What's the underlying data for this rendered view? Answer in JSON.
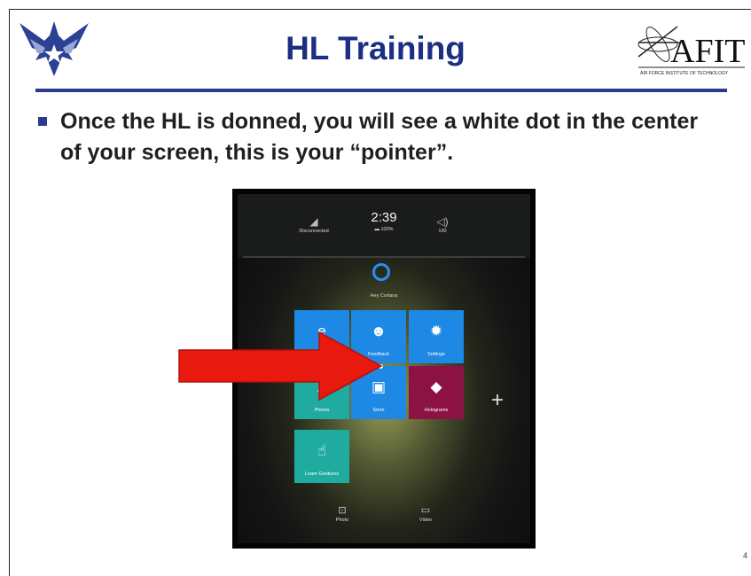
{
  "header": {
    "title": "HL Training"
  },
  "logos": {
    "right_logo_text": "AFIT",
    "right_logo_subtext": "AIR FORCE INSTITUTE OF TECHNOLOGY"
  },
  "bullet": {
    "text": "Once the HL is donned, you will see a white dot in the center of your screen, this is your “pointer”."
  },
  "holo_menu": {
    "status": {
      "network": {
        "icon": "wifi-off-icon",
        "label": "Disconnected"
      },
      "time": "2:39",
      "battery": {
        "icon": "battery-icon",
        "label": "100%"
      },
      "volume": {
        "icon": "volume-icon",
        "label": "100"
      }
    },
    "cortana": {
      "icon": "cortana-icon",
      "label": "Hey Cortana"
    },
    "tiles": [
      {
        "icon": "edge-icon",
        "glyph": "e",
        "label": "",
        "color": "#1e88e5"
      },
      {
        "icon": "feedback-icon",
        "glyph": "☻",
        "label": "Feedback",
        "color": "#1e88e5"
      },
      {
        "icon": "settings-icon",
        "glyph": "✹",
        "label": "Settings",
        "color": "#1e88e5"
      },
      {
        "icon": "photos-icon",
        "glyph": "▲",
        "label": "Photos",
        "color": "#1fab9f"
      },
      {
        "icon": "store-icon",
        "glyph": "▣",
        "label": "Store",
        "color": "#1e88e5"
      },
      {
        "icon": "holograms-icon",
        "glyph": "◆",
        "label": "Holograms",
        "color": "#8b1242"
      },
      {
        "icon": "learn-gestures-icon",
        "glyph": "☝",
        "label": "Learn Gestures",
        "color": "#1fab9f"
      }
    ],
    "add_label": "+",
    "capture": [
      {
        "icon": "photo-icon",
        "glyph": "⊡",
        "label": "Photo"
      },
      {
        "icon": "video-icon",
        "glyph": "▭",
        "label": "Video"
      }
    ]
  },
  "colors": {
    "title": "#1c2f82",
    "rule": "#2b3a8e",
    "arrow": "#e8190f"
  },
  "page_number": "4"
}
